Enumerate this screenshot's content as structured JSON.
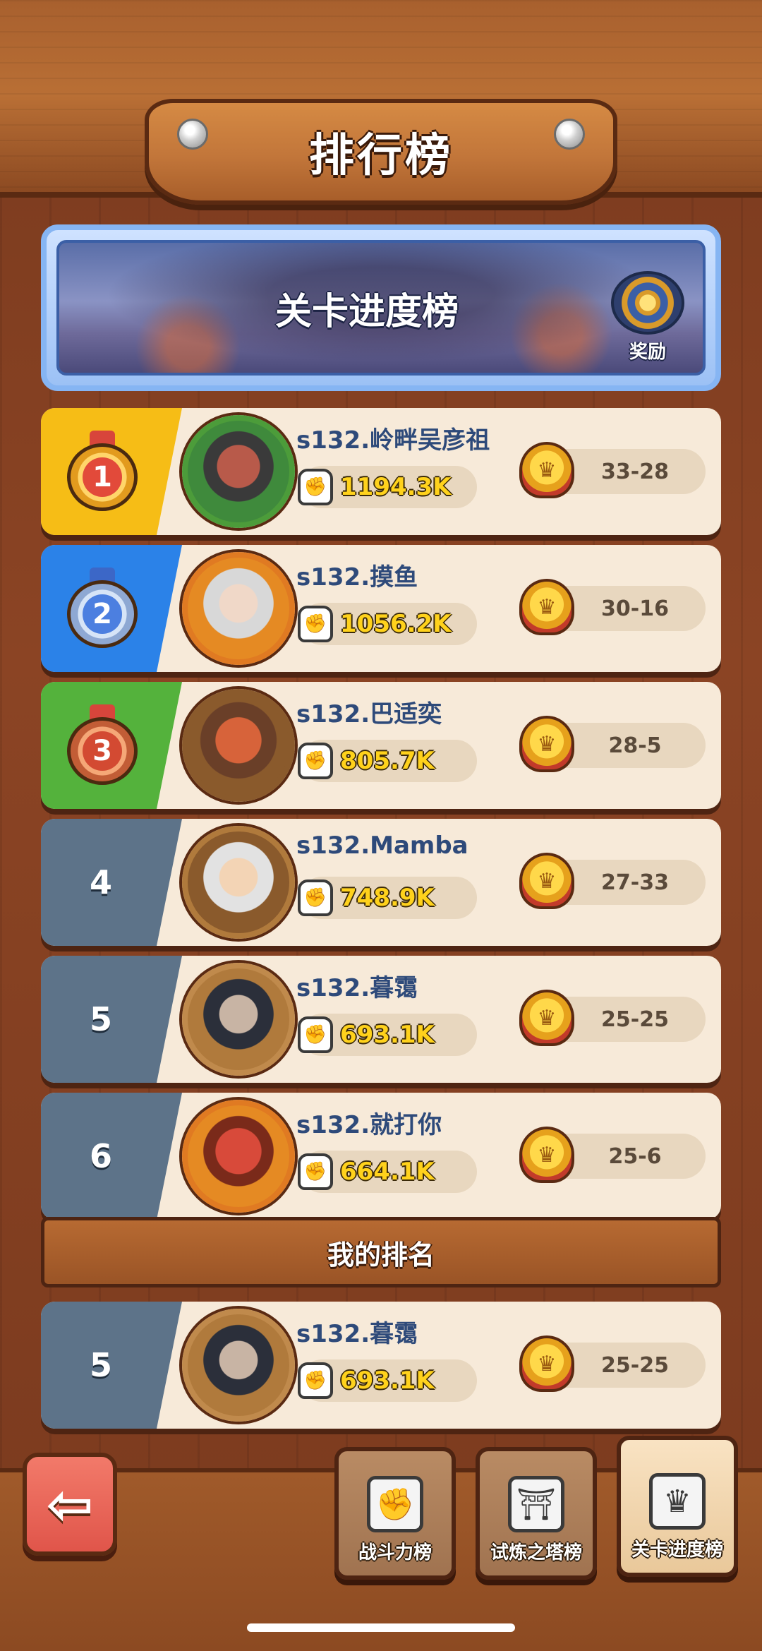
{
  "header": {
    "title": "排行榜"
  },
  "banner": {
    "title": "关卡进度榜",
    "reward_label": "奖励"
  },
  "rows": [
    {
      "rank": "1",
      "name": "s132.岭畔吴彦祖",
      "power": "1194.3K",
      "stage": "33-28"
    },
    {
      "rank": "2",
      "name": "s132.摸鱼",
      "power": "1056.2K",
      "stage": "30-16"
    },
    {
      "rank": "3",
      "name": "s132.巴适奕",
      "power": "805.7K",
      "stage": "28-5"
    },
    {
      "rank": "4",
      "name": "s132.Mamba",
      "power": "748.9K",
      "stage": "27-33"
    },
    {
      "rank": "5",
      "name": "s132.暮霭",
      "power": "693.1K",
      "stage": "25-25"
    },
    {
      "rank": "6",
      "name": "s132.就打你",
      "power": "664.1K",
      "stage": "25-6"
    }
  ],
  "my_rank": {
    "header": "我的排名",
    "rank": "5",
    "name": "s132.暮霭",
    "power": "693.1K",
    "stage": "25-25"
  },
  "tabs": [
    {
      "label": "战斗力榜",
      "icon": "fist-icon",
      "active": false
    },
    {
      "label": "试炼之塔榜",
      "icon": "tower-icon",
      "active": false
    },
    {
      "label": "关卡进度榜",
      "icon": "crown-shield-icon",
      "active": true
    }
  ],
  "colors": {
    "gold": "#f6bd16",
    "blue": "#2b82e8",
    "green": "#54b23c",
    "gray": "#5d7389",
    "power_text": "#ffd21c",
    "name_text": "#2e4a7a"
  }
}
